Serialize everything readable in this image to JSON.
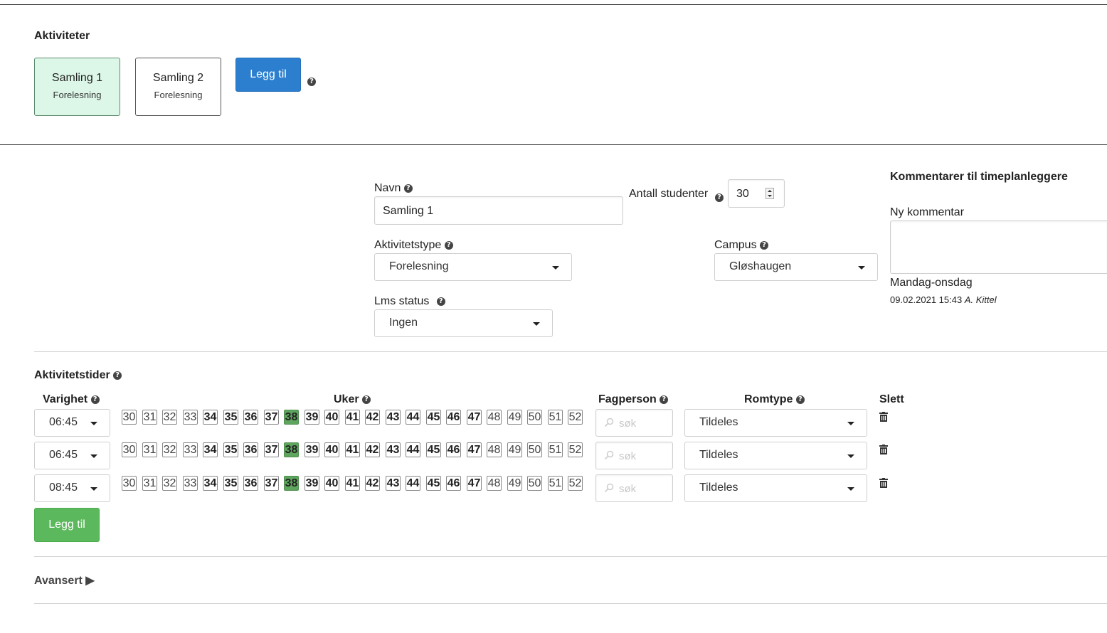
{
  "activities": {
    "title": "Aktiviteter",
    "cards": [
      {
        "name": "Samling 1",
        "type": "Forelesning",
        "selected": true
      },
      {
        "name": "Samling 2",
        "type": "Forelesning",
        "selected": false
      }
    ],
    "add_label": "Legg til"
  },
  "form": {
    "name_label": "Navn",
    "name_value": "Samling 1",
    "students_label": "Antall studenter",
    "students_value": "30",
    "activity_type_label": "Aktivitetstype",
    "activity_type_value": "Forelesning",
    "campus_label": "Campus",
    "campus_value": "Gløshaugen",
    "lms_label": "Lms status",
    "lms_value": "Ingen"
  },
  "comments": {
    "title": "Kommentarer til timeplanleggere",
    "new_label": "Ny kommentar",
    "entry_text": "Mandag-onsdag",
    "entry_date": "09.02.2021 15:43",
    "entry_author": "A. Kittel"
  },
  "times": {
    "title": "Aktivitetstider",
    "col_duration": "Varighet",
    "col_weeks": "Uker",
    "col_person": "Fagperson",
    "col_roomtype": "Romtype",
    "col_delete": "Slett",
    "weeks": [
      {
        "n": "30",
        "s": "normal"
      },
      {
        "n": "31",
        "s": "normal"
      },
      {
        "n": "32",
        "s": "normal"
      },
      {
        "n": "33",
        "s": "normal"
      },
      {
        "n": "34",
        "s": "bold"
      },
      {
        "n": "35",
        "s": "bold"
      },
      {
        "n": "36",
        "s": "bold"
      },
      {
        "n": "37",
        "s": "bold"
      },
      {
        "n": "38",
        "s": "selected"
      },
      {
        "n": "39",
        "s": "bold"
      },
      {
        "n": "40",
        "s": "bold"
      },
      {
        "n": "41",
        "s": "bold"
      },
      {
        "n": "42",
        "s": "bold"
      },
      {
        "n": "43",
        "s": "bold"
      },
      {
        "n": "44",
        "s": "bold"
      },
      {
        "n": "45",
        "s": "bold"
      },
      {
        "n": "46",
        "s": "bold"
      },
      {
        "n": "47",
        "s": "bold"
      },
      {
        "n": "48",
        "s": "normal"
      },
      {
        "n": "49",
        "s": "normal"
      },
      {
        "n": "50",
        "s": "normal"
      },
      {
        "n": "51",
        "s": "normal"
      },
      {
        "n": "52",
        "s": "normal"
      }
    ],
    "rows": [
      {
        "duration": "06:45",
        "person_placeholder": "søk",
        "roomtype": "Tildeles"
      },
      {
        "duration": "06:45",
        "person_placeholder": "søk",
        "roomtype": "Tildeles"
      },
      {
        "duration": "08:45",
        "person_placeholder": "søk",
        "roomtype": "Tildeles"
      }
    ],
    "add_label": "Legg til"
  },
  "advanced": {
    "label": "Avansert ▶"
  },
  "icons": {
    "help": "question-circle-icon",
    "caret": "caret-down-icon",
    "trash": "trash-icon",
    "search": "search-icon"
  },
  "colors": {
    "primary": "#2b7fce",
    "success": "#5cb85c",
    "selected_card_bg": "#dcf7e8",
    "selected_week": "#5ea65e"
  }
}
